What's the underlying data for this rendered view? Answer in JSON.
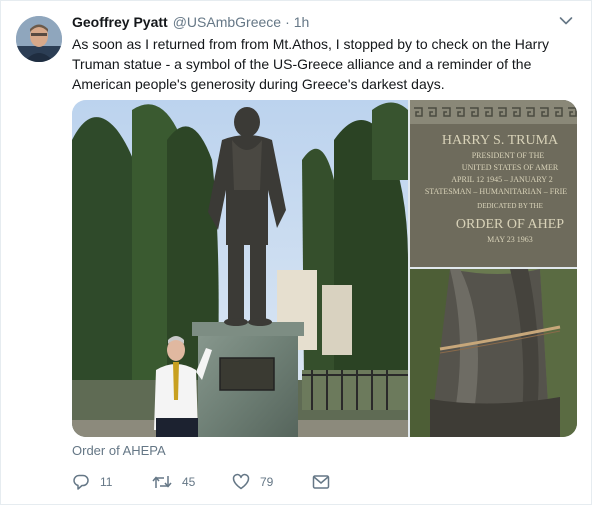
{
  "tweet": {
    "author_name": "Geoffrey Pyatt",
    "handle": "@USAmbGreece",
    "separator": "·",
    "time": "1h",
    "text": "As soon as I returned from from Mt.Athos, I stopped by to check on the Harry Truman statue - a symbol of the US-Greece alliance and a reminder of the American people's generosity during Greece's darkest days.",
    "media_caption": "Order of AHEPA",
    "plaque": {
      "line1": "HARRY S. TRUMA",
      "line2": "PRESIDENT OF THE",
      "line3": "UNITED STATES OF AMER",
      "line4": "APRIL 12 1945 – JANUARY 2",
      "line5": "STATESMAN – HUMANITARIAN – FRIE",
      "line6": "DEDICATED BY THE",
      "line7": "ORDER OF AHEP",
      "line8": "MAY 23 1963"
    }
  },
  "actions": {
    "reply_count": "11",
    "retweet_count": "45",
    "like_count": "79"
  },
  "icons": {
    "caret": "chevron-down-icon",
    "reply": "reply-icon",
    "retweet": "retweet-icon",
    "like": "heart-icon",
    "dm": "envelope-icon"
  },
  "colors": {
    "text_primary": "#14171a",
    "text_secondary": "#657786",
    "border": "#e6ecf0"
  }
}
